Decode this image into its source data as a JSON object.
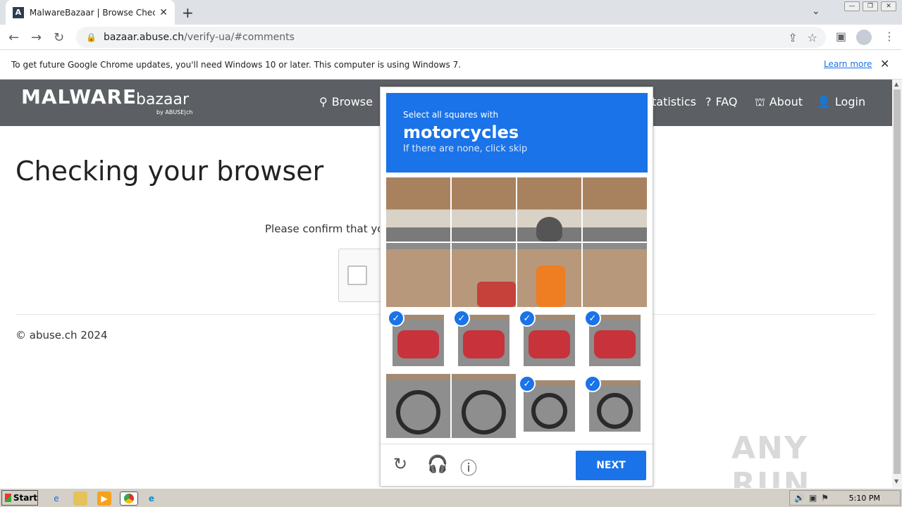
{
  "browser": {
    "tab_title": "MalwareBazaar | Browse Checking y",
    "tab_favicon": "A",
    "url_host": "bazaar.abuse.ch",
    "url_path": "/verify-ua/#comments",
    "infobar_message": "To get future Google Chrome updates, you'll need Windows 10 or later. This computer is using Windows 7.",
    "infobar_link": "Learn more"
  },
  "site": {
    "logo_main": "MALWARE",
    "logo_sub": "bazaar",
    "logo_by": "by ABUSE|ch",
    "nav": [
      "Browse",
      "Statistics",
      "FAQ",
      "About",
      "Login"
    ],
    "nav_partial_statistics": "tatistics",
    "heading": "Checking your browser",
    "confirm_text": "Please confirm that you",
    "footer": "© abuse.ch 2024",
    "watermark": "ANY RUN"
  },
  "captcha": {
    "line1": "Select all squares with",
    "line2": "motorcycles",
    "line3": "If there are none, click skip",
    "selected_tiles": [
      8,
      9,
      10,
      11,
      14,
      15
    ],
    "next_label": "NEXT"
  },
  "taskbar": {
    "start_label": "Start",
    "clock": "5:10 PM"
  },
  "colors": {
    "accent": "#1a73e8",
    "site_header": "#5c6064"
  }
}
